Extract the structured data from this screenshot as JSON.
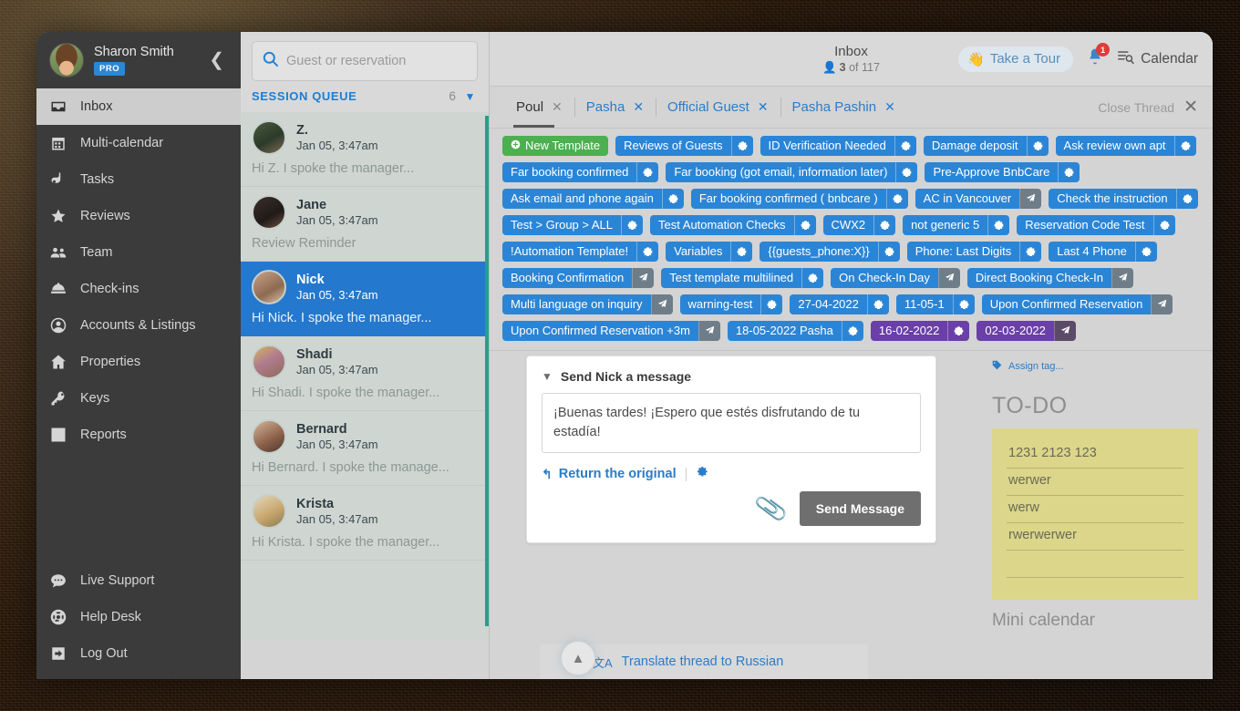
{
  "sidebar": {
    "profile": {
      "name": "Sharon Smith",
      "badge": "PRO",
      "collapse_icon": "chevron-left-icon"
    },
    "items": [
      {
        "label": "Inbox",
        "icon": "inbox-icon",
        "active": true
      },
      {
        "label": "Multi-calendar",
        "icon": "calendar-icon",
        "active": false
      },
      {
        "label": "Tasks",
        "icon": "tasks-icon",
        "active": false
      },
      {
        "label": "Reviews",
        "icon": "star-icon",
        "active": false
      },
      {
        "label": "Team",
        "icon": "users-icon",
        "active": false
      },
      {
        "label": "Check-ins",
        "icon": "bell-desk-icon",
        "active": false
      },
      {
        "label": "Accounts & Listings",
        "icon": "user-circle-icon",
        "active": false
      },
      {
        "label": "Properties",
        "icon": "home-icon",
        "active": false
      },
      {
        "label": "Keys",
        "icon": "key-icon",
        "active": false
      },
      {
        "label": "Reports",
        "icon": "bar-chart-icon",
        "active": false
      }
    ],
    "bottom_items": [
      {
        "label": "Live Support",
        "icon": "chat-icon"
      },
      {
        "label": "Help Desk",
        "icon": "life-ring-icon"
      },
      {
        "label": "Log Out",
        "icon": "logout-icon"
      }
    ]
  },
  "threads_panel": {
    "search": {
      "placeholder": "Guest or reservation",
      "value": "",
      "icon": "search-icon"
    },
    "queue_label": "SESSION QUEUE",
    "queue_count": "6",
    "queue_chevron": "chevron-down-icon",
    "threads": [
      {
        "name": "Z.",
        "date": "Jan 05, 3:47am",
        "preview": "Hi Z. I spoke the manager...",
        "selected": false
      },
      {
        "name": "Jane",
        "date": "Jan 05, 3:47am",
        "preview": "Review Reminder",
        "selected": false
      },
      {
        "name": "Nick",
        "date": "Jan 05, 3:47am",
        "preview": "Hi Nick. I spoke the manager...",
        "selected": true
      },
      {
        "name": "Shadi",
        "date": "Jan 05, 3:47am",
        "preview": "Hi Shadi. I spoke the manager...",
        "selected": false
      },
      {
        "name": "Bernard",
        "date": "Jan 05, 3:47am",
        "preview": "Hi Bernard. I spoke the manage...",
        "selected": false
      },
      {
        "name": "Krista",
        "date": "Jan 05, 3:47am",
        "preview": "Hi Krista. I spoke the manager...",
        "selected": false
      }
    ]
  },
  "topbar": {
    "title": "Inbox",
    "subtitle_count": "3",
    "subtitle_rest": "of 117",
    "person_icon": "person-icon",
    "tour_button": {
      "label": "Take a Tour",
      "icon": "waving-hand-icon"
    },
    "notifications": {
      "icon": "bell-icon",
      "count": "1"
    },
    "calendar_button": {
      "label": "Calendar",
      "icon": "calendar-list-icon"
    }
  },
  "tabs": {
    "items": [
      {
        "label": "Poul",
        "active": true
      },
      {
        "label": "Pasha",
        "active": false
      },
      {
        "label": "Official Guest",
        "active": false
      },
      {
        "label": "Pasha Pashin",
        "active": false
      }
    ],
    "close_thread": {
      "label": "Close Thread",
      "icon": "close-icon"
    }
  },
  "tags": [
    {
      "label": "New Template",
      "color": "green",
      "icon": "plus-circle-icon",
      "action_icon": null
    },
    {
      "label": "Reviews of Guests",
      "color": "blue",
      "action_icon": "gear-icon"
    },
    {
      "label": "ID Verification Needed",
      "color": "blue",
      "action_icon": "gear-icon"
    },
    {
      "label": "Damage deposit",
      "color": "blue",
      "action_icon": "gear-icon"
    },
    {
      "label": "Ask review own apt",
      "color": "blue",
      "action_icon": "gear-icon"
    },
    {
      "label": "Far booking confirmed",
      "color": "blue",
      "action_icon": "gear-icon"
    },
    {
      "label": "Far booking (got email, information later)",
      "color": "blue",
      "action_icon": "gear-icon"
    },
    {
      "label": "Pre-Approve BnbCare",
      "color": "blue",
      "action_icon": "gear-icon"
    },
    {
      "label": "Ask email and phone again",
      "color": "blue",
      "action_icon": "gear-icon"
    },
    {
      "label": "Far booking confirmed ( bnbcare )",
      "color": "blue",
      "action_icon": "gear-icon"
    },
    {
      "label": "AC in Vancouver",
      "color": "blue",
      "action_icon": "plane-icon",
      "action_dark": true
    },
    {
      "label": "Check the instruction",
      "color": "blue",
      "action_icon": "gear-icon"
    },
    {
      "label": "Test > Group > ALL",
      "color": "blue",
      "action_icon": "gear-icon"
    },
    {
      "label": "Test Automation Checks",
      "color": "blue",
      "action_icon": "gear-icon"
    },
    {
      "label": "CWX2",
      "color": "blue",
      "action_icon": "gear-icon"
    },
    {
      "label": "not generic 5",
      "color": "blue",
      "action_icon": "gear-icon"
    },
    {
      "label": "Reservation Code Test",
      "color": "blue",
      "action_icon": "gear-icon"
    },
    {
      "label": "!Automation Template!",
      "color": "blue",
      "action_icon": "gear-icon"
    },
    {
      "label": "Variables",
      "color": "blue",
      "action_icon": "gear-icon"
    },
    {
      "label": "{{guests_phone:X}}",
      "color": "blue",
      "action_icon": "gear-icon"
    },
    {
      "label": "Phone: Last Digits",
      "color": "blue",
      "action_icon": "gear-icon"
    },
    {
      "label": "Last 4 Phone",
      "color": "blue",
      "action_icon": "gear-icon"
    },
    {
      "label": "Booking Confirmation",
      "color": "blue",
      "action_icon": "plane-icon",
      "action_dark": true
    },
    {
      "label": "Test template multilined",
      "color": "blue",
      "action_icon": "gear-icon"
    },
    {
      "label": "On Check-In Day",
      "color": "blue",
      "action_icon": "plane-icon",
      "action_dark": true
    },
    {
      "label": "Direct Booking Check-In",
      "color": "blue",
      "action_icon": "plane-icon",
      "action_dark": true
    },
    {
      "label": "Multi language on inquiry",
      "color": "blue",
      "action_icon": "plane-icon",
      "action_dark": true
    },
    {
      "label": "warning-test",
      "color": "blue",
      "action_icon": "gear-icon"
    },
    {
      "label": "27-04-2022",
      "color": "blue",
      "action_icon": "gear-icon"
    },
    {
      "label": "11-05-1",
      "color": "blue",
      "action_icon": "gear-icon"
    },
    {
      "label": "Upon Confirmed Reservation",
      "color": "blue",
      "action_icon": "plane-icon",
      "action_dark": true
    },
    {
      "label": "Upon Confirmed Reservation +3m",
      "color": "blue",
      "action_icon": "plane-icon",
      "action_dark": true
    },
    {
      "label": "18-05-2022 Pasha",
      "color": "blue",
      "action_icon": "gear-icon"
    },
    {
      "label": "16-02-2022",
      "color": "purple",
      "action_icon": "gear-icon"
    },
    {
      "label": "02-03-2022",
      "color": "purple",
      "action_icon": "plane-icon",
      "action_dark": true
    }
  ],
  "compose": {
    "header": "Send Nick a message",
    "header_chevron": "chevron-down-icon",
    "message": "¡Buenas tardes! ¡Espero que estés disfrutando de tu estadía!",
    "return_original": "Return the original",
    "return_icon": "undo-icon",
    "settings_icon": "gear-icon",
    "attach_icon": "paperclip-icon",
    "send_label": "Send Message"
  },
  "translate": {
    "label": "Translate thread to Russian",
    "icon": "translate-icon",
    "collapse_icon": "chevron-up-icon"
  },
  "right_pane": {
    "assign_tag": {
      "label": "Assign tag...",
      "icon": "tag-icon"
    },
    "todo_title": "TO-DO",
    "todo_items": [
      "1231 2123 123",
      "werwer",
      "werw",
      "rwerwerwer",
      ""
    ],
    "mini_calendar_title": "Mini calendar"
  },
  "colors": {
    "accent_blue": "#2b85d6",
    "green": "#4caf50",
    "purple": "#6a3fa8",
    "selected_thread": "#2478cd",
    "queue_bar": "#23a08a",
    "todo_card": "#dbd68a",
    "badge_red": "#e03b3b"
  }
}
